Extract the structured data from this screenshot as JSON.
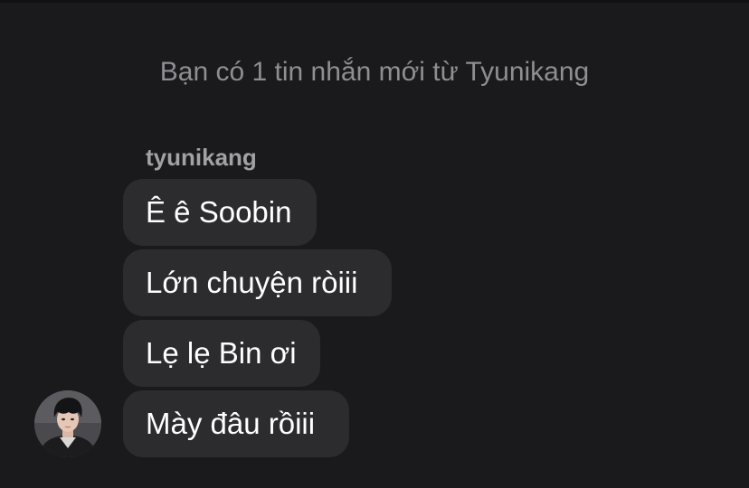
{
  "notification": {
    "text": "Bạn có 1 tin nhắn mới từ Tyunikang"
  },
  "conversation": {
    "sender_name": "tyunikang",
    "messages": [
      {
        "text": "Ê ê Soobin"
      },
      {
        "text": "Lớn chuyện ròiii"
      },
      {
        "text": "Lẹ lẹ Bin ơi"
      },
      {
        "text": "Mày đâu rồiii"
      }
    ]
  },
  "colors": {
    "background": "#1a1a1c",
    "bubble": "#2c2c2e",
    "notice_text": "#8e8e93",
    "sender_text": "#a1a1a6",
    "message_text": "#ffffff"
  }
}
